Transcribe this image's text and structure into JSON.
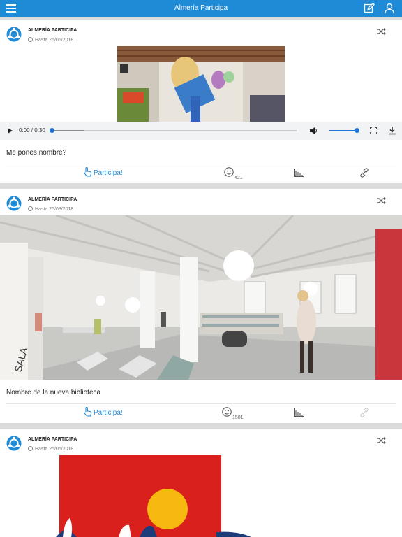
{
  "header": {
    "title": "Almería Participa",
    "menu_icon": "hamburger-menu-icon",
    "edit_icon": "edit-icon",
    "profile_icon": "user-icon"
  },
  "posts": [
    {
      "org": "ALMERÍA PARTICIPA",
      "date": "Hasta 25/05/2018",
      "caption": "Me pones nombre?",
      "participa_label": "Participa!",
      "smiley_count": "421",
      "audio_time": "0:00 / 0:30",
      "audio_progress": 0.0,
      "volume_level": 0.95,
      "image": "market-hall-photo"
    },
    {
      "org": "ALMERÍA PARTICIPA",
      "date": "Hasta 25/08/2018",
      "caption": "Nombre de la nueva biblioteca",
      "participa_label": "Participa!",
      "smiley_count": "1581",
      "image": "library-render",
      "image_text": "SALA"
    },
    {
      "org": "ALMERÍA PARTICIPA",
      "date": "Hasta 25/05/2018",
      "image": "red-poster"
    }
  ],
  "colors": {
    "accent": "#1f8ad6",
    "background": "#dcdcdc"
  }
}
